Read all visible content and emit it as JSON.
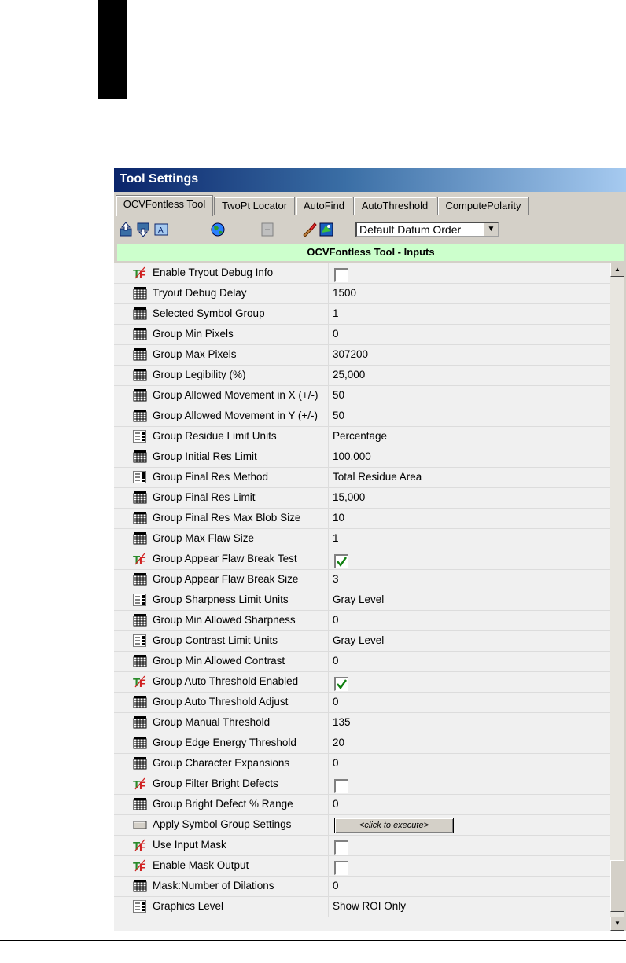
{
  "panel": {
    "title": "Tool Settings",
    "tabs": [
      {
        "label": "OCVFontless Tool"
      },
      {
        "label": "TwoPt Locator"
      },
      {
        "label": "AutoFind"
      },
      {
        "label": "AutoThreshold"
      },
      {
        "label": "ComputePolarity"
      }
    ],
    "toolbar": {
      "datum_combo_value": "Default Datum Order"
    },
    "section_title": "OCVFontless Tool - Inputs",
    "rows": [
      {
        "label": "Enable Tryout Debug Info",
        "icon": "tf-icon",
        "type": "check",
        "checked": false
      },
      {
        "label": "Tryout Debug Delay",
        "icon": "grid-icon",
        "type": "text",
        "value": "1500"
      },
      {
        "label": "Selected Symbol Group",
        "icon": "grid-icon",
        "type": "text",
        "value": "1"
      },
      {
        "label": "Group Min Pixels",
        "icon": "grid-icon",
        "type": "text",
        "value": "0"
      },
      {
        "label": "Group Max Pixels",
        "icon": "grid-icon",
        "type": "text",
        "value": "307200"
      },
      {
        "label": "Group Legibility (%)",
        "icon": "grid-icon",
        "type": "text",
        "value": "25,000"
      },
      {
        "label": "Group Allowed Movement in X (+/-)",
        "icon": "grid-icon",
        "type": "text",
        "value": "50"
      },
      {
        "label": "Group Allowed Movement in Y (+/-)",
        "icon": "grid-icon",
        "type": "text",
        "value": "50"
      },
      {
        "label": "Group Residue Limit Units",
        "icon": "list-icon",
        "type": "text",
        "value": "Percentage"
      },
      {
        "label": "Group Initial Res Limit",
        "icon": "grid-icon",
        "type": "text",
        "value": "100,000"
      },
      {
        "label": "Group Final Res Method",
        "icon": "list-icon",
        "type": "text",
        "value": "Total Residue Area"
      },
      {
        "label": "Group Final Res Limit",
        "icon": "grid-icon",
        "type": "text",
        "value": "15,000"
      },
      {
        "label": "Group Final Res Max Blob Size",
        "icon": "grid-icon",
        "type": "text",
        "value": "10"
      },
      {
        "label": "Group Max Flaw Size",
        "icon": "grid-icon",
        "type": "text",
        "value": "1"
      },
      {
        "label": "Group Appear Flaw Break Test",
        "icon": "tf-icon",
        "type": "check",
        "checked": true
      },
      {
        "label": "Group Appear Flaw Break Size",
        "icon": "grid-icon",
        "type": "text",
        "value": "3"
      },
      {
        "label": "Group Sharpness Limit Units",
        "icon": "list-icon",
        "type": "text",
        "value": "Gray Level"
      },
      {
        "label": "Group Min Allowed Sharpness",
        "icon": "grid-icon",
        "type": "text",
        "value": "0"
      },
      {
        "label": "Group Contrast Limit Units",
        "icon": "list-icon",
        "type": "text",
        "value": "Gray Level"
      },
      {
        "label": "Group Min Allowed Contrast",
        "icon": "grid-icon",
        "type": "text",
        "value": "0"
      },
      {
        "label": "Group Auto Threshold Enabled",
        "icon": "tf-icon",
        "type": "check",
        "checked": true
      },
      {
        "label": "Group Auto Threshold Adjust",
        "icon": "grid-icon",
        "type": "text",
        "value": "0"
      },
      {
        "label": "Group Manual Threshold",
        "icon": "grid-icon",
        "type": "text",
        "value": "135"
      },
      {
        "label": "Group Edge Energy Threshold",
        "icon": "grid-icon",
        "type": "text",
        "value": "20"
      },
      {
        "label": "Group Character Expansions",
        "icon": "grid-icon",
        "type": "text",
        "value": "0"
      },
      {
        "label": "Group Filter Bright Defects",
        "icon": "tf-icon",
        "type": "check",
        "checked": false
      },
      {
        "label": "Group Bright Defect % Range",
        "icon": "grid-icon",
        "type": "text",
        "value": "0"
      },
      {
        "label": "Apply Symbol Group Settings",
        "icon": "button-icon",
        "type": "button",
        "value": "<click to execute>"
      },
      {
        "label": "Use Input Mask",
        "icon": "tf-icon",
        "type": "check",
        "checked": false
      },
      {
        "label": "Enable Mask Output",
        "icon": "tf-icon",
        "type": "check",
        "checked": false
      },
      {
        "label": "Mask:Number of Dilations",
        "icon": "grid-icon",
        "type": "text",
        "value": "0"
      },
      {
        "label": "Graphics Level",
        "icon": "list-icon",
        "type": "text",
        "value": "Show ROI Only"
      }
    ]
  }
}
